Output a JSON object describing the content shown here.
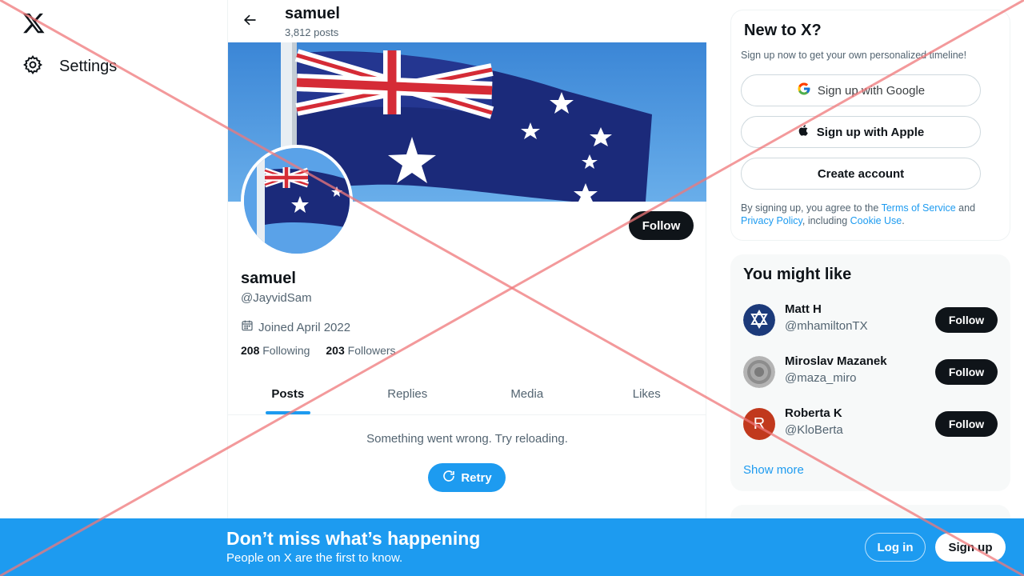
{
  "nav": {
    "logo_icon": "x-logo-icon",
    "settings_label": "Settings",
    "settings_icon": "gear-icon"
  },
  "header": {
    "back_icon": "arrow-left-icon",
    "title": "samuel",
    "posts_count": "3,812 posts"
  },
  "profile": {
    "name": "samuel",
    "handle": "@JayvidSam",
    "joined": "Joined April 2022",
    "joined_icon": "calendar-icon",
    "following_count": "208",
    "following_label": "Following",
    "followers_count": "203",
    "followers_label": "Followers",
    "follow_label": "Follow",
    "banner_subject": "australian-flag",
    "avatar_subject": "australian-flag"
  },
  "tabs": [
    {
      "label": "Posts",
      "active": true
    },
    {
      "label": "Replies",
      "active": false
    },
    {
      "label": "Media",
      "active": false
    },
    {
      "label": "Likes",
      "active": false
    }
  ],
  "feed": {
    "error_text": "Something went wrong. Try reloading.",
    "retry_label": "Retry",
    "retry_icon": "refresh-icon"
  },
  "new_to_x": {
    "title": "New to X?",
    "subtitle": "Sign up now to get your own personalized timeline!",
    "google_label": "Sign up with Google",
    "apple_label": "Sign up with Apple",
    "create_label": "Create account",
    "terms_prefix": "By signing up, you agree to the ",
    "terms_link": "Terms of Service",
    "terms_and": " and ",
    "privacy_link": "Privacy Policy",
    "terms_including": ", including ",
    "cookie_link": "Cookie Use",
    "terms_end": "."
  },
  "you_might_like": {
    "title": "You might like",
    "suggestions": [
      {
        "name": "Matt H",
        "handle": "@mhamiltonTX",
        "follow_label": "Follow"
      },
      {
        "name": "Miroslav Mazanek",
        "handle": "@maza_miro",
        "follow_label": "Follow"
      },
      {
        "name": "Roberta K",
        "handle": "@KloBerta",
        "follow_label": "Follow",
        "initial": "R"
      }
    ],
    "show_more": "Show more"
  },
  "bottom_bar": {
    "title": "Don’t miss what’s happening",
    "subtitle": "People on X are the first to know.",
    "login_label": "Log in",
    "signup_label": "Sign up"
  },
  "colors": {
    "accent": "#1d9bf0",
    "dark": "#0f1419",
    "muted": "#536471",
    "overlay_x": "#f0787a"
  }
}
